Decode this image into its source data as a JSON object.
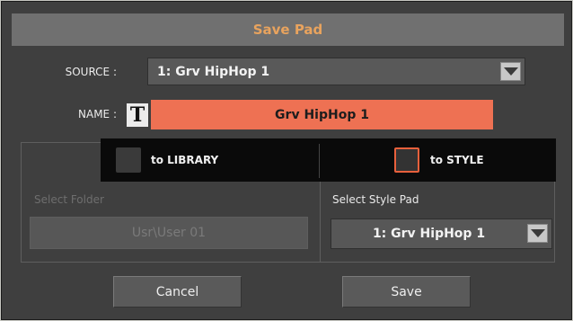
{
  "dialog": {
    "title": "Save Pad",
    "title_color": "#e8a35e"
  },
  "source": {
    "label": "SOURCE :",
    "value": "1: Grv HipHop 1",
    "dropdown_icon": "triangle-down-icon"
  },
  "name": {
    "label": "NAME :",
    "text_icon": "T",
    "value": "Grv HipHop 1",
    "field_color": "#ee7153"
  },
  "destination": {
    "library": {
      "label": "to LIBRARY",
      "checked": false
    },
    "style": {
      "label": "to STYLE",
      "checked": true,
      "accent": "#e8603c"
    }
  },
  "folder": {
    "label": "Select Folder",
    "value": "Usr\\User 01",
    "enabled": false
  },
  "style_pad": {
    "label": "Select Style Pad",
    "value": "1: Grv HipHop 1",
    "dropdown_icon": "triangle-down-icon"
  },
  "buttons": {
    "cancel": "Cancel",
    "save": "Save"
  }
}
